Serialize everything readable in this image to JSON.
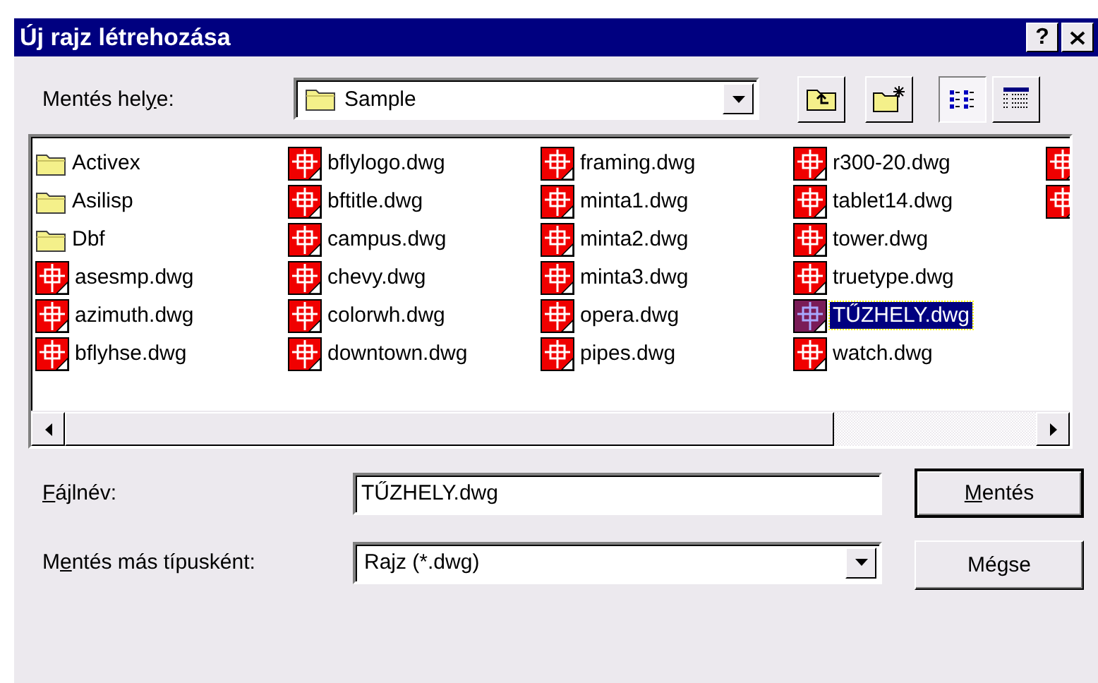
{
  "window": {
    "title": "Új rajz létrehozása",
    "help": "?"
  },
  "save_in": {
    "label": [
      {
        "text": "Mentés hel",
        "underline": false
      },
      {
        "text": "y",
        "underline": true
      },
      {
        "text": "e:",
        "underline": false
      }
    ],
    "value": "Sample"
  },
  "toolbar": [
    {
      "kind": "up",
      "selected": false
    },
    {
      "kind": "new_folder",
      "selected": false
    },
    {
      "kind": "list",
      "selected": true
    },
    {
      "kind": "details",
      "selected": false
    }
  ],
  "files": [
    {
      "name": "Activex",
      "kind": "folder",
      "selected": false
    },
    {
      "name": "Asilisp",
      "kind": "folder",
      "selected": false
    },
    {
      "name": "Dbf",
      "kind": "folder",
      "selected": false
    },
    {
      "name": "asesmp.dwg",
      "kind": "dwg",
      "selected": false
    },
    {
      "name": "azimuth.dwg",
      "kind": "dwg",
      "selected": false
    },
    {
      "name": "bflyhse.dwg",
      "kind": "dwg",
      "selected": false
    },
    {
      "name": "bflylogo.dwg",
      "kind": "dwg",
      "selected": false
    },
    {
      "name": "bftitle.dwg",
      "kind": "dwg",
      "selected": false
    },
    {
      "name": "campus.dwg",
      "kind": "dwg",
      "selected": false
    },
    {
      "name": "chevy.dwg",
      "kind": "dwg",
      "selected": false
    },
    {
      "name": "colorwh.dwg",
      "kind": "dwg",
      "selected": false
    },
    {
      "name": "downtown.dwg",
      "kind": "dwg",
      "selected": false
    },
    {
      "name": "framing.dwg",
      "kind": "dwg",
      "selected": false
    },
    {
      "name": "minta1.dwg",
      "kind": "dwg",
      "selected": false
    },
    {
      "name": "minta2.dwg",
      "kind": "dwg",
      "selected": false
    },
    {
      "name": "minta3.dwg",
      "kind": "dwg",
      "selected": false
    },
    {
      "name": "opera.dwg",
      "kind": "dwg",
      "selected": false
    },
    {
      "name": "pipes.dwg",
      "kind": "dwg",
      "selected": false
    },
    {
      "name": "r300-20.dwg",
      "kind": "dwg",
      "selected": false
    },
    {
      "name": "tablet14.dwg",
      "kind": "dwg",
      "selected": false
    },
    {
      "name": "tower.dwg",
      "kind": "dwg",
      "selected": false
    },
    {
      "name": "truetype.dwg",
      "kind": "dwg",
      "selected": false
    },
    {
      "name": "TŰZHELY.dwg",
      "kind": "dwg",
      "selected": true
    },
    {
      "name": "watch.dwg",
      "kind": "dwg",
      "selected": false
    },
    {
      "kind": "dwg",
      "selected": false
    },
    {
      "kind": "dwg",
      "selected": false
    }
  ],
  "file_name": {
    "label": [
      {
        "text": "F",
        "underline": true
      },
      {
        "text": "ájlnév:",
        "underline": false
      }
    ],
    "value": "TŰZHELY.dwg"
  },
  "file_type": {
    "label": [
      {
        "text": "M",
        "underline": false
      },
      {
        "text": "e",
        "underline": true
      },
      {
        "text": "ntés más típusként:",
        "underline": false
      }
    ],
    "value": "Rajz (*.dwg)"
  },
  "buttons": [
    {
      "label": [
        {
          "text": "M",
          "underline": true
        },
        {
          "text": "entés",
          "underline": false
        }
      ],
      "default": true
    },
    {
      "label": [
        {
          "text": "Mégse",
          "underline": false
        }
      ],
      "default": false
    }
  ]
}
